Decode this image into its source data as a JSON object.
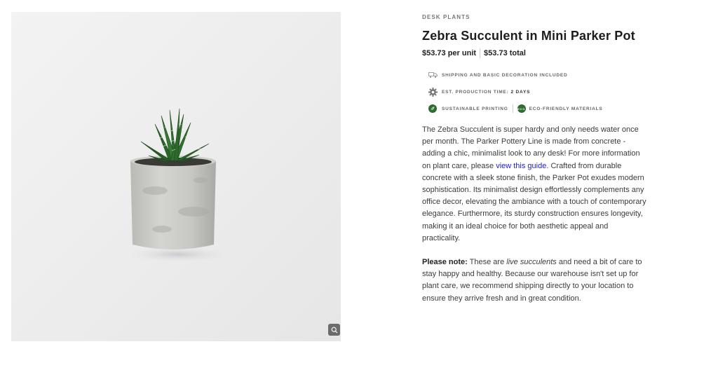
{
  "product": {
    "category": "DESK PLANTS",
    "title": "Zebra Succulent in Mini Parker Pot",
    "price_unit": "$53.73 per unit",
    "price_total": "$53.73 total"
  },
  "features": {
    "shipping": "SHIPPING AND BASIC DECORATION INCLUDED",
    "production_label": "EST. PRODUCTION TIME:",
    "production_value": "2 DAYS",
    "sustainable": "SUSTAINABLE PRINTING",
    "eco_badge": "ECO",
    "eco": "ECO-FRIENDLY MATERIALS"
  },
  "description": {
    "part1": "The Zebra Succulent is super hardy and only needs water once per month. The Parker Pottery Line is made from concrete - adding a chic, minimalist look to any desk! For more information on plant care, please ",
    "link": "view this guide",
    "part2": ". Crafted from durable concrete with a sleek stone finish, the Parker Pot exudes modern sophistication. Its minimalist design effortlessly complements any office decor, elevating the ambiance with a touch of contemporary elegance. Furthermore, its sturdy construction ensures longevity, making it an ideal choice for both aesthetic appeal and practicality."
  },
  "note": {
    "label": "Please note:",
    "pre": " These are ",
    "emphasis": "live succulents",
    "post": " and need a bit of care to stay happy and healthy. Because our warehouse isn't set up for plant care, we recommend shipping directly to your location to ensure they arrive fresh and in great condition."
  },
  "icons": {
    "zoom": "magnifier-icon",
    "shipping": "truck-icon",
    "production": "gear-icon",
    "sustainable": "leaf-icon",
    "eco": "eco-badge-icon"
  },
  "colors": {
    "eco_green": "#2e6b2e",
    "link": "#2222cc"
  }
}
